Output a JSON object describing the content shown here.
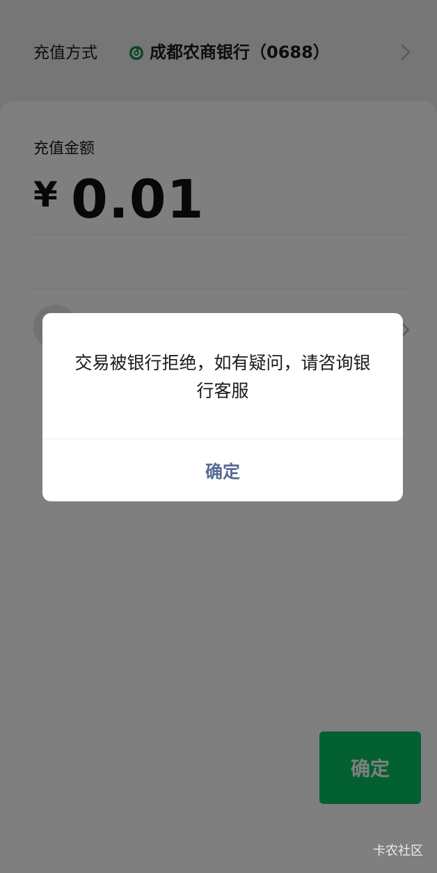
{
  "payment_method": {
    "label": "充值方式",
    "bank_name": "成都农商银行（0688）",
    "bank_icon": "bank-logo-icon",
    "chevron_icon": "chevron-right-icon"
  },
  "amount": {
    "label": "充值金额",
    "currency_symbol": "¥",
    "value": "0.01"
  },
  "confirm_button": {
    "label": "确定",
    "color": "#07c160"
  },
  "dialog": {
    "message": "交易被银行拒绝，如有疑问，请咨询银行客服",
    "button_label": "确定",
    "button_color": "#576b95"
  },
  "watermark": "卡农社区"
}
